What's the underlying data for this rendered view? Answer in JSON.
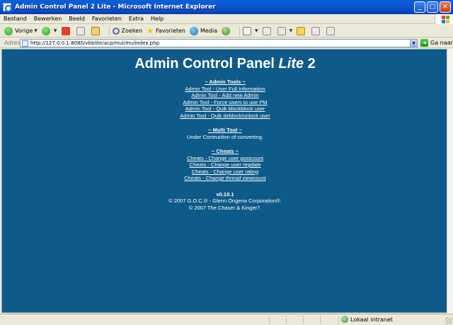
{
  "window": {
    "title": "Admin Control Panel 2 Lite - Microsoft Internet Explorer",
    "minimize": "_",
    "maximize": "□",
    "close": "✕"
  },
  "menu": {
    "items": [
      "Bestand",
      "Bewerken",
      "Beeld",
      "Favorieten",
      "Extra",
      "Help"
    ]
  },
  "toolbar": {
    "back_label": "Vorige",
    "search_label": "Zoeken",
    "favorites_label": "Favorieten",
    "media_label": "Media"
  },
  "address": {
    "label": "Adres",
    "value": "http://127.0.0.1:8080/vbblite/acp/mul/mulindex.php",
    "go_label": "Ga naar"
  },
  "page": {
    "title_main": "Admin Control Panel ",
    "title_em": "Lite",
    "title_end": " 2",
    "sections": [
      {
        "heading": "~ Admin Tools ~",
        "links": [
          "Admin Tool - User Full Information",
          "Admin Tool - Add new Admin",
          "Admin Tool - Force users to use PM",
          "Admin Tool - Quik blockblock user",
          "Admin Tool - Quik deblock/unlock user"
        ]
      },
      {
        "heading": "~ Multi Tool ~",
        "text": "Under Contruction of converting."
      },
      {
        "heading": "~ Cheats ~",
        "links": [
          "Cheats - Change user postcount",
          "Cheats - Change user regdate",
          "Cheats - Change user rating",
          "Cheats - Change thread viewcount"
        ]
      }
    ],
    "version": "v0.10.1",
    "copyright1": "© 2007 G.O.C.® - Glenn Ongena Corporation®.",
    "copyright2": "© 2007 The Chaser & Kinger7."
  },
  "status": {
    "zone": "Lokaal intranet"
  },
  "colors": {
    "page_bg": "#0e5a88",
    "titlebar": "#0b58d0"
  }
}
